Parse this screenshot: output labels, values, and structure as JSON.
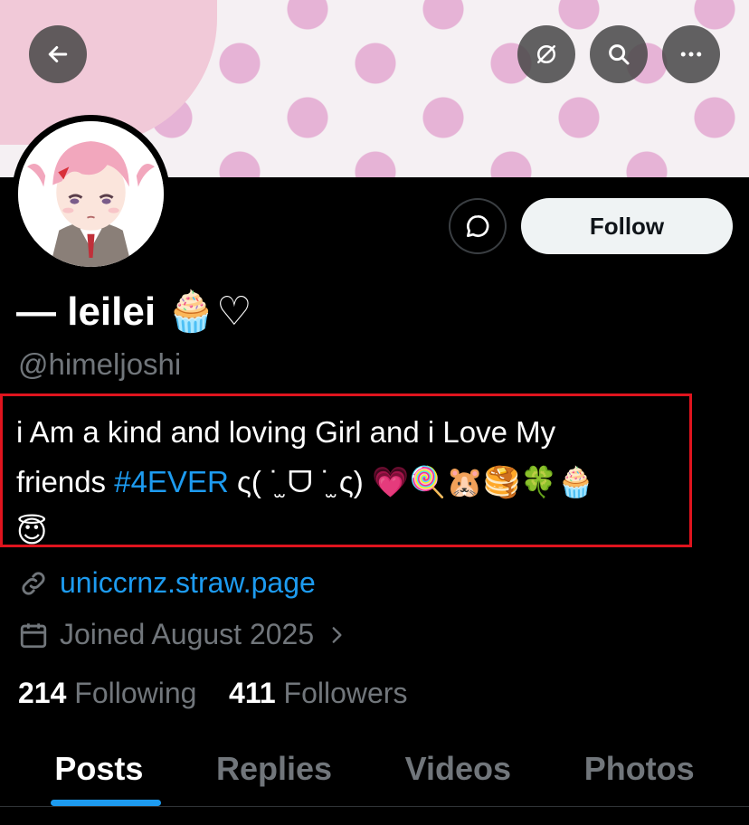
{
  "header": {
    "back_icon": "arrow-left-icon",
    "actions": [
      "translate-off-icon",
      "search-icon",
      "more-icon"
    ]
  },
  "profile": {
    "display_name": "— leilei 🧁♡",
    "handle": "@himeljoshi",
    "bio_line1": "i Am a kind and loving Girl and i Love My",
    "bio_line2_prefix": "friends ",
    "hashtag": "#4EVER",
    "bio_line2_suffix": " ς( ˙̫ ᗜ ˙̫ ς) 💗🍭🐹🥞🍀🧁",
    "bio_line3": "😇",
    "website": "uniccrnz.straw.page",
    "joined": "Joined August 2025",
    "following_count": "214",
    "following_label": "Following",
    "followers_count": "411",
    "followers_label": "Followers"
  },
  "actions": {
    "follow_label": "Follow"
  },
  "tabs": [
    {
      "label": "Posts",
      "active": true
    },
    {
      "label": "Replies",
      "active": false
    },
    {
      "label": "Videos",
      "active": false
    },
    {
      "label": "Photos",
      "active": false
    }
  ],
  "colors": {
    "accent": "#1d9bf0",
    "highlight_border": "#e0141e",
    "background": "#000000"
  }
}
